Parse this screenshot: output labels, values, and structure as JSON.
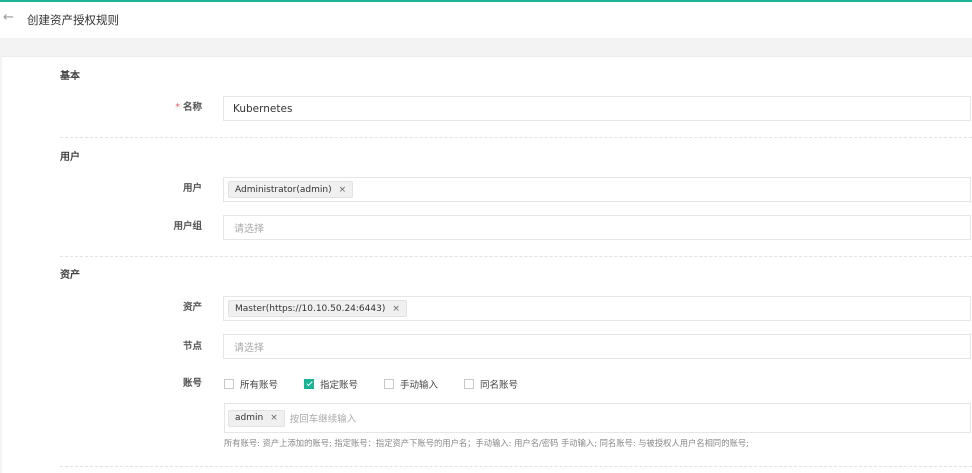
{
  "header": {
    "title": "创建资产授权规则"
  },
  "sections": {
    "basic": {
      "title": "基本",
      "name_label": "名称",
      "name_required": "*",
      "name_value": "Kubernetes"
    },
    "user": {
      "title": "用户",
      "users_label": "用户",
      "users_tags": [
        "Administrator(admin)"
      ],
      "groups_label": "用户组",
      "groups_placeholder": "请选择"
    },
    "asset": {
      "title": "资产",
      "assets_label": "资产",
      "assets_tags": [
        "Master(https://10.10.50.24:6443)"
      ],
      "nodes_label": "节点",
      "nodes_placeholder": "请选择",
      "accounts_label": "账号",
      "account_options": [
        {
          "label": "所有账号",
          "checked": false
        },
        {
          "label": "指定账号",
          "checked": true
        },
        {
          "label": "手动输入",
          "checked": false
        },
        {
          "label": "同名账号",
          "checked": false
        }
      ],
      "account_tags": [
        "admin"
      ],
      "account_input_placeholder": "按回车继续输入",
      "help_text": "所有账号: 资产上添加的账号; 指定账号：指定资产下账号的用户名；手动输入: 用户名/密码 手动输入; 同名账号: 与被授权人用户名相同的账号;"
    }
  },
  "icons": {
    "back": "arrow-left-icon",
    "tag_close": "close-icon",
    "checkbox_checked": "check-icon"
  },
  "colors": {
    "accent": "#1ab394",
    "required": "#ed5565"
  }
}
